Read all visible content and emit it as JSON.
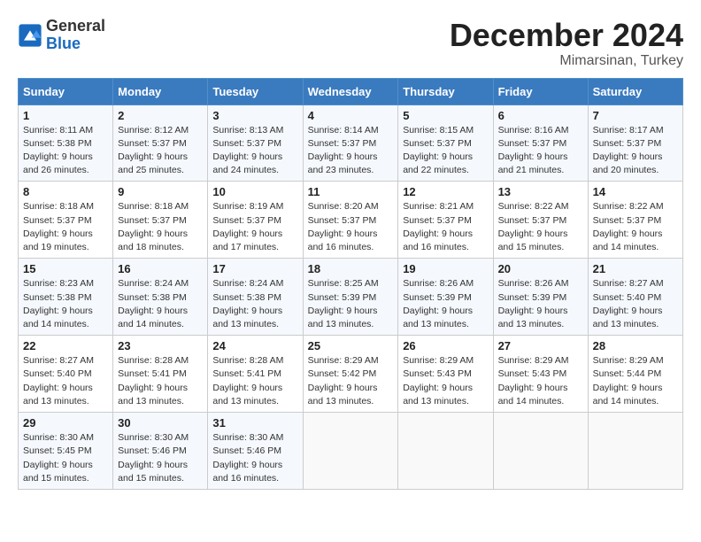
{
  "header": {
    "logo_line1": "General",
    "logo_line2": "Blue",
    "title": "December 2024",
    "subtitle": "Mimarsinan, Turkey"
  },
  "days_of_week": [
    "Sunday",
    "Monday",
    "Tuesday",
    "Wednesday",
    "Thursday",
    "Friday",
    "Saturday"
  ],
  "weeks": [
    [
      {
        "day": "1",
        "sunrise": "Sunrise: 8:11 AM",
        "sunset": "Sunset: 5:38 PM",
        "daylight": "Daylight: 9 hours and 26 minutes."
      },
      {
        "day": "2",
        "sunrise": "Sunrise: 8:12 AM",
        "sunset": "Sunset: 5:37 PM",
        "daylight": "Daylight: 9 hours and 25 minutes."
      },
      {
        "day": "3",
        "sunrise": "Sunrise: 8:13 AM",
        "sunset": "Sunset: 5:37 PM",
        "daylight": "Daylight: 9 hours and 24 minutes."
      },
      {
        "day": "4",
        "sunrise": "Sunrise: 8:14 AM",
        "sunset": "Sunset: 5:37 PM",
        "daylight": "Daylight: 9 hours and 23 minutes."
      },
      {
        "day": "5",
        "sunrise": "Sunrise: 8:15 AM",
        "sunset": "Sunset: 5:37 PM",
        "daylight": "Daylight: 9 hours and 22 minutes."
      },
      {
        "day": "6",
        "sunrise": "Sunrise: 8:16 AM",
        "sunset": "Sunset: 5:37 PM",
        "daylight": "Daylight: 9 hours and 21 minutes."
      },
      {
        "day": "7",
        "sunrise": "Sunrise: 8:17 AM",
        "sunset": "Sunset: 5:37 PM",
        "daylight": "Daylight: 9 hours and 20 minutes."
      }
    ],
    [
      {
        "day": "8",
        "sunrise": "Sunrise: 8:18 AM",
        "sunset": "Sunset: 5:37 PM",
        "daylight": "Daylight: 9 hours and 19 minutes."
      },
      {
        "day": "9",
        "sunrise": "Sunrise: 8:18 AM",
        "sunset": "Sunset: 5:37 PM",
        "daylight": "Daylight: 9 hours and 18 minutes."
      },
      {
        "day": "10",
        "sunrise": "Sunrise: 8:19 AM",
        "sunset": "Sunset: 5:37 PM",
        "daylight": "Daylight: 9 hours and 17 minutes."
      },
      {
        "day": "11",
        "sunrise": "Sunrise: 8:20 AM",
        "sunset": "Sunset: 5:37 PM",
        "daylight": "Daylight: 9 hours and 16 minutes."
      },
      {
        "day": "12",
        "sunrise": "Sunrise: 8:21 AM",
        "sunset": "Sunset: 5:37 PM",
        "daylight": "Daylight: 9 hours and 16 minutes."
      },
      {
        "day": "13",
        "sunrise": "Sunrise: 8:22 AM",
        "sunset": "Sunset: 5:37 PM",
        "daylight": "Daylight: 9 hours and 15 minutes."
      },
      {
        "day": "14",
        "sunrise": "Sunrise: 8:22 AM",
        "sunset": "Sunset: 5:37 PM",
        "daylight": "Daylight: 9 hours and 14 minutes."
      }
    ],
    [
      {
        "day": "15",
        "sunrise": "Sunrise: 8:23 AM",
        "sunset": "Sunset: 5:38 PM",
        "daylight": "Daylight: 9 hours and 14 minutes."
      },
      {
        "day": "16",
        "sunrise": "Sunrise: 8:24 AM",
        "sunset": "Sunset: 5:38 PM",
        "daylight": "Daylight: 9 hours and 14 minutes."
      },
      {
        "day": "17",
        "sunrise": "Sunrise: 8:24 AM",
        "sunset": "Sunset: 5:38 PM",
        "daylight": "Daylight: 9 hours and 13 minutes."
      },
      {
        "day": "18",
        "sunrise": "Sunrise: 8:25 AM",
        "sunset": "Sunset: 5:39 PM",
        "daylight": "Daylight: 9 hours and 13 minutes."
      },
      {
        "day": "19",
        "sunrise": "Sunrise: 8:26 AM",
        "sunset": "Sunset: 5:39 PM",
        "daylight": "Daylight: 9 hours and 13 minutes."
      },
      {
        "day": "20",
        "sunrise": "Sunrise: 8:26 AM",
        "sunset": "Sunset: 5:39 PM",
        "daylight": "Daylight: 9 hours and 13 minutes."
      },
      {
        "day": "21",
        "sunrise": "Sunrise: 8:27 AM",
        "sunset": "Sunset: 5:40 PM",
        "daylight": "Daylight: 9 hours and 13 minutes."
      }
    ],
    [
      {
        "day": "22",
        "sunrise": "Sunrise: 8:27 AM",
        "sunset": "Sunset: 5:40 PM",
        "daylight": "Daylight: 9 hours and 13 minutes."
      },
      {
        "day": "23",
        "sunrise": "Sunrise: 8:28 AM",
        "sunset": "Sunset: 5:41 PM",
        "daylight": "Daylight: 9 hours and 13 minutes."
      },
      {
        "day": "24",
        "sunrise": "Sunrise: 8:28 AM",
        "sunset": "Sunset: 5:41 PM",
        "daylight": "Daylight: 9 hours and 13 minutes."
      },
      {
        "day": "25",
        "sunrise": "Sunrise: 8:29 AM",
        "sunset": "Sunset: 5:42 PM",
        "daylight": "Daylight: 9 hours and 13 minutes."
      },
      {
        "day": "26",
        "sunrise": "Sunrise: 8:29 AM",
        "sunset": "Sunset: 5:43 PM",
        "daylight": "Daylight: 9 hours and 13 minutes."
      },
      {
        "day": "27",
        "sunrise": "Sunrise: 8:29 AM",
        "sunset": "Sunset: 5:43 PM",
        "daylight": "Daylight: 9 hours and 14 minutes."
      },
      {
        "day": "28",
        "sunrise": "Sunrise: 8:29 AM",
        "sunset": "Sunset: 5:44 PM",
        "daylight": "Daylight: 9 hours and 14 minutes."
      }
    ],
    [
      {
        "day": "29",
        "sunrise": "Sunrise: 8:30 AM",
        "sunset": "Sunset: 5:45 PM",
        "daylight": "Daylight: 9 hours and 15 minutes."
      },
      {
        "day": "30",
        "sunrise": "Sunrise: 8:30 AM",
        "sunset": "Sunset: 5:46 PM",
        "daylight": "Daylight: 9 hours and 15 minutes."
      },
      {
        "day": "31",
        "sunrise": "Sunrise: 8:30 AM",
        "sunset": "Sunset: 5:46 PM",
        "daylight": "Daylight: 9 hours and 16 minutes."
      },
      null,
      null,
      null,
      null
    ]
  ]
}
